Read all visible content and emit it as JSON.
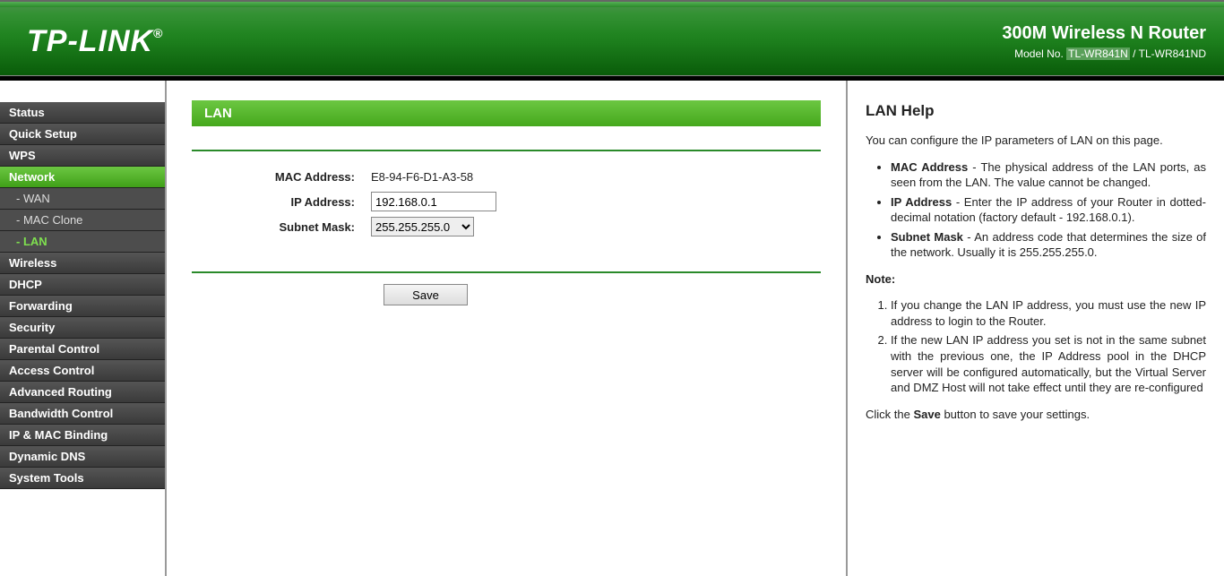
{
  "header": {
    "logo": "TP-LINK",
    "reg": "®",
    "product": "300M Wireless N Router",
    "model_label": "Model No.",
    "model_hl": "TL-WR841N",
    "model_sep": " / ",
    "model_rest": "TL-WR841ND"
  },
  "sidebar": {
    "status": "Status",
    "quick_setup": "Quick Setup",
    "wps": "WPS",
    "network": "Network",
    "wan": "- WAN",
    "mac_clone": "- MAC Clone",
    "lan": "- LAN",
    "wireless": "Wireless",
    "dhcp": "DHCP",
    "forwarding": "Forwarding",
    "security": "Security",
    "parental": "Parental Control",
    "access": "Access Control",
    "adv_routing": "Advanced Routing",
    "bandwidth": "Bandwidth Control",
    "ip_mac": "IP & MAC Binding",
    "ddns": "Dynamic DNS",
    "systools": "System Tools"
  },
  "main": {
    "title": "LAN",
    "mac_label": "MAC Address:",
    "mac_value": "E8-94-F6-D1-A3-58",
    "ip_label": "IP Address:",
    "ip_value": "192.168.0.1",
    "mask_label": "Subnet Mask:",
    "mask_value": "255.255.255.0",
    "save": "Save"
  },
  "help": {
    "title": "LAN Help",
    "intro": "You can configure the IP parameters of LAN on this page.",
    "b1_k": "MAC Address",
    "b1_v": " - The physical address of the LAN ports, as seen from the LAN. The value cannot be changed.",
    "b2_k": "IP Address",
    "b2_v": " - Enter the IP address of your Router in dotted-decimal notation (factory default - 192.168.0.1).",
    "b3_k": "Subnet Mask",
    "b3_v": " - An address code that determines the size of the network. Usually it is 255.255.255.0.",
    "note_label": "Note:",
    "n1": "If you change the LAN IP address, you must use the new IP address to login to the Router.",
    "n2": "If the new LAN IP address you set is not in the same subnet with the previous one, the IP Address pool in the DHCP server will be configured automatically, but the Virtual Server and DMZ Host will not take effect until they are re-configured",
    "save_pre": "Click the ",
    "save_b": "Save",
    "save_post": " button to save your settings."
  }
}
